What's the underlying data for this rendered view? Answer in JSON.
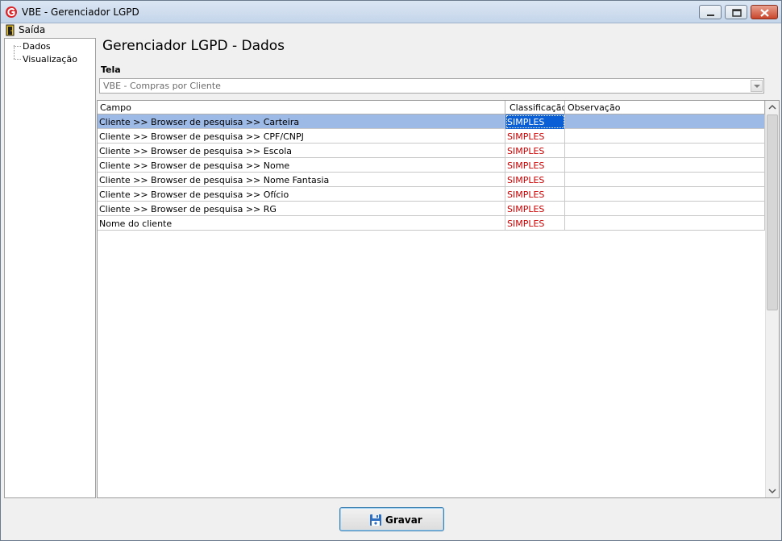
{
  "window": {
    "title": "VBE - Gerenciador LGPD",
    "app_icon": "vbe-logo-icon",
    "controls": [
      "minimize-icon",
      "maximize-icon",
      "close-icon"
    ]
  },
  "menu": {
    "items": [
      {
        "label": "Saída",
        "icon": "exit-door-icon"
      }
    ]
  },
  "tree": {
    "items": [
      {
        "label": "Dados"
      },
      {
        "label": "Visualização"
      }
    ]
  },
  "main": {
    "title": "Gerenciador LGPD - Dados",
    "tela_label": "Tela",
    "tela_value": "VBE - Compras por Cliente"
  },
  "grid": {
    "columns": [
      "Campo",
      "Classificação",
      "Observação"
    ],
    "rows": [
      {
        "campo": "Cliente >> Browser de pesquisa >> Carteira",
        "classificacao": "SIMPLES",
        "observacao": ""
      },
      {
        "campo": "Cliente >> Browser de pesquisa >> CPF/CNPJ",
        "classificacao": "SIMPLES",
        "observacao": ""
      },
      {
        "campo": "Cliente >> Browser de pesquisa >> Escola",
        "classificacao": "SIMPLES",
        "observacao": ""
      },
      {
        "campo": "Cliente >> Browser de pesquisa >> Nome",
        "classificacao": "SIMPLES",
        "observacao": ""
      },
      {
        "campo": "Cliente >> Browser de pesquisa >> Nome Fantasia",
        "classificacao": "SIMPLES",
        "observacao": ""
      },
      {
        "campo": "Cliente >> Browser de pesquisa >> Ofício",
        "classificacao": "SIMPLES",
        "observacao": ""
      },
      {
        "campo": "Cliente >> Browser de pesquisa >> RG",
        "classificacao": "SIMPLES",
        "observacao": ""
      },
      {
        "campo": "Nome do cliente",
        "classificacao": "SIMPLES",
        "observacao": ""
      }
    ],
    "selected_row": 0
  },
  "footer": {
    "save_label": "Gravar",
    "save_icon": "floppy-disk-icon"
  },
  "colors": {
    "selection": "#9db9e6",
    "selected_cell": "#0a5fd6",
    "classification_text": "#cc0000"
  }
}
